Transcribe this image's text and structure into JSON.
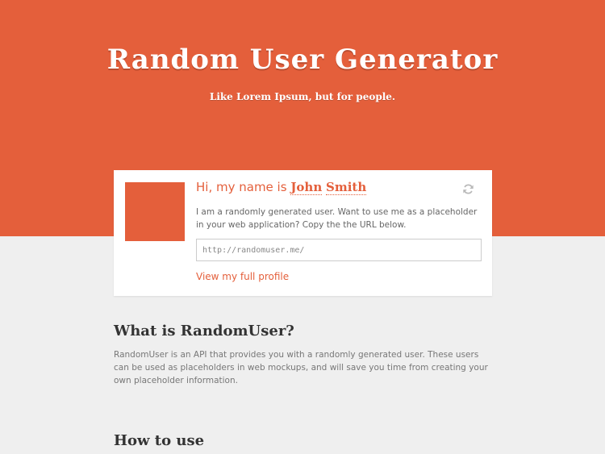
{
  "header": {
    "title": "Random User Generator",
    "tagline": "Like Lorem Ipsum, but for people."
  },
  "user_card": {
    "greeting_prefix": "Hi, my name is ",
    "first_name": "John",
    "last_name": "Smith",
    "description": "I am a randomly generated user. Want to use me as a placeholder in your web application? Copy the the URL below.",
    "url_value": "http://randomuser.me/",
    "profile_link": "View my full profile",
    "refresh_icon": "refresh-icon"
  },
  "about": {
    "heading": "What is RandomUser?",
    "body": "RandomUser is an API that provides you with a randomly generated user. These users can be used as placeholders in web mockups, and will save you time from creating your own placeholder information."
  },
  "usage": {
    "heading": "How to use"
  },
  "colors": {
    "accent": "#e45f3b",
    "page_background": "#efefef",
    "card_background": "#ffffff"
  }
}
